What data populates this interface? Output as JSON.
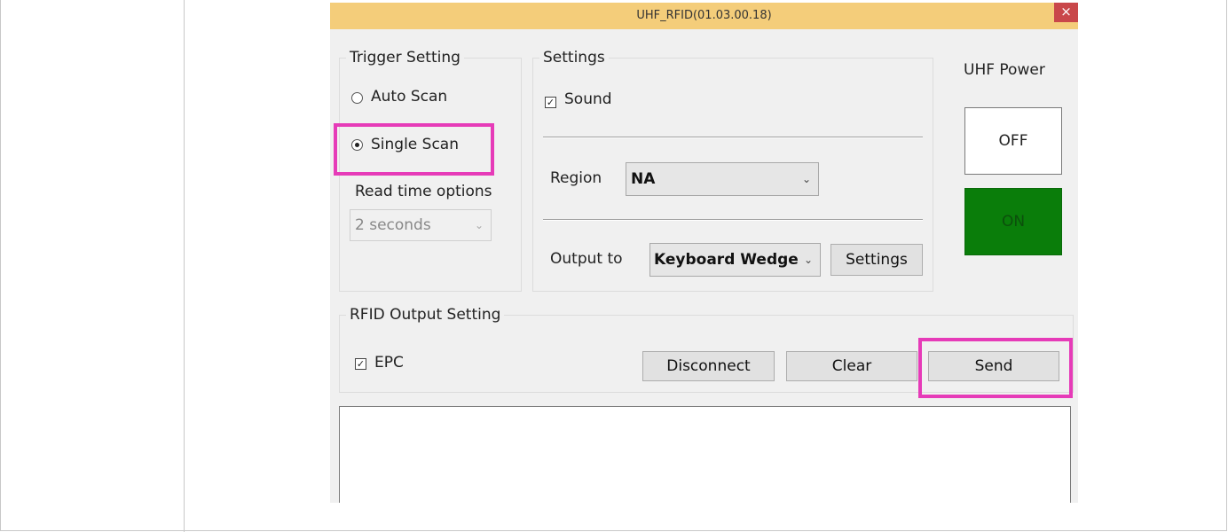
{
  "window": {
    "title": "UHF_RFID(01.03.00.18)",
    "close_symbol": "×"
  },
  "trigger": {
    "legend": "Trigger Setting",
    "auto_scan_label": "Auto Scan",
    "auto_scan_selected": false,
    "single_scan_label": "Single Scan",
    "single_scan_selected": true,
    "read_time_label": "Read time options",
    "read_time_value": "2 seconds",
    "read_time_enabled": false
  },
  "settings": {
    "legend": "Settings",
    "sound_label": "Sound",
    "sound_checked": true,
    "region_label": "Region",
    "region_value": "NA",
    "output_label": "Output to",
    "output_value": "Keyboard Wedge",
    "settings_button": "Settings"
  },
  "power": {
    "label": "UHF Power",
    "off_label": "OFF",
    "on_label": "ON",
    "on_color": "#0a7d0a",
    "off_color": "#ffffff"
  },
  "rfid_output": {
    "legend": "RFID Output Setting",
    "epc_label": "EPC",
    "epc_checked": true,
    "disconnect_button": "Disconnect",
    "clear_button": "Clear",
    "send_button": "Send"
  },
  "colors": {
    "titlebar": "#f4cd7a",
    "highlight": "#e63bb8"
  }
}
